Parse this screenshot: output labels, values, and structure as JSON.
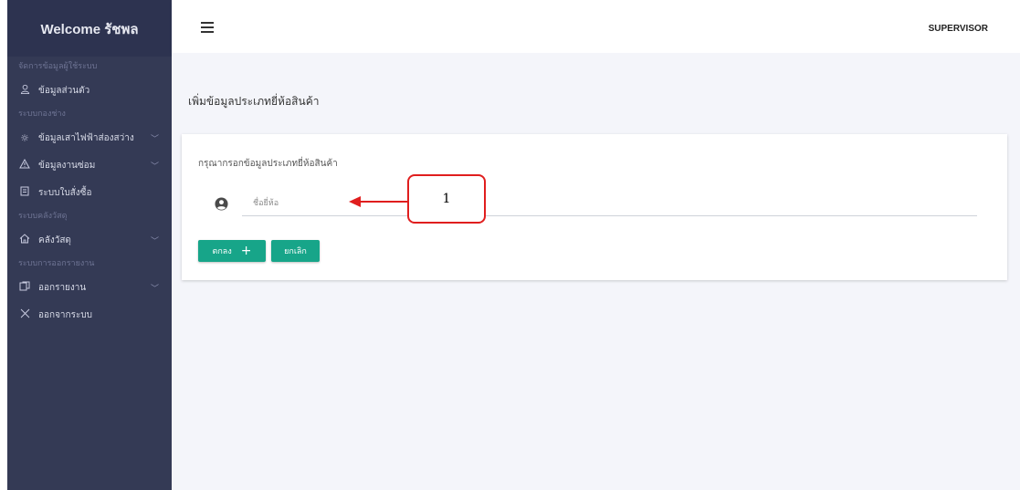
{
  "sidebar": {
    "welcome": "Welcome รัชพล",
    "sections": [
      "จัดการข้อมูลผู้ใช้ระบบ",
      "ระบบกองช่าง",
      "ระบบคลังวัสดุ",
      "ระบบการออกรายงาน"
    ],
    "items": [
      {
        "label": "ข้อมูลส่วนตัว",
        "icon": "user-icon"
      },
      {
        "label": "ข้อมูลเสาไฟฟ้าส่องสว่าง",
        "icon": "sun-icon"
      },
      {
        "label": "ข้อมูลงานซ่อม",
        "icon": "warning-icon"
      },
      {
        "label": "ระบบใบสั่งซื้อ",
        "icon": "document-icon"
      },
      {
        "label": "คลังวัสดุ",
        "icon": "home-icon"
      },
      {
        "label": "ออกรายงาน",
        "icon": "report-icon"
      },
      {
        "label": "ออกจากระบบ",
        "icon": "close-icon"
      }
    ]
  },
  "header": {
    "role": "SUPERVISOR",
    "menu_icon": "hamburger-icon"
  },
  "main": {
    "page_title": "เพิ่มข้อมูลประเภทยี่ห้อสินค้า",
    "form": {
      "instruction": "กรุณากรอกข้อมูลประเภทยี่ห้อสินค้า",
      "brand_field": {
        "placeholder": "ชื่อยี่ห้อ",
        "value": "",
        "icon": "account-circle-icon"
      },
      "ok_label": "ตกลง",
      "ok_icon": "+",
      "cancel_label": "ยกเลิก"
    }
  },
  "annotation": {
    "number": "1",
    "color": "#e01e1e"
  },
  "colors": {
    "sidebar_bg": "#343a55",
    "accent": "#17a589",
    "page_bg": "#f4f5fa"
  }
}
